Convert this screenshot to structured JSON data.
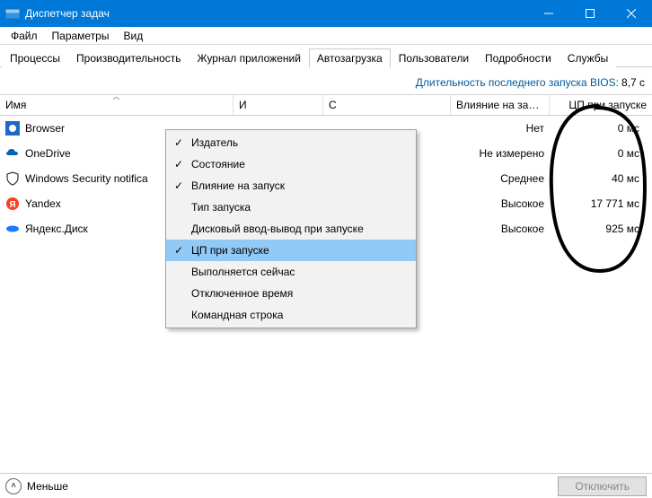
{
  "window": {
    "title": "Диспетчер задач"
  },
  "menu": {
    "file": "Файл",
    "options": "Параметры",
    "view": "Вид"
  },
  "tabs": {
    "processes": "Процессы",
    "performance": "Производительность",
    "apphistory": "Журнал приложений",
    "startup": "Автозагрузка",
    "users": "Пользователи",
    "details": "Подробности",
    "services": "Службы",
    "active": "startup"
  },
  "bios": {
    "label": "Длительность последнего запуска BIOS:",
    "value": "8,7 с"
  },
  "columns": {
    "name": "Имя",
    "publisher": "И",
    "state": "С",
    "impact": "Влияние на за…",
    "cpu": "ЦП при запуске"
  },
  "rows": [
    {
      "icon": "browser",
      "name": "Browser",
      "impact": "Нет",
      "cpu": "0 мс"
    },
    {
      "icon": "onedrive",
      "name": "OneDrive",
      "impact": "Не измерено",
      "cpu": "0 мс"
    },
    {
      "icon": "shield",
      "name": "Windows Security notifica",
      "impact": "Среднее",
      "cpu": "40 мс"
    },
    {
      "icon": "yandex",
      "name": "Yandex",
      "impact": "Высокое",
      "cpu": "17 771 мс"
    },
    {
      "icon": "disk",
      "name": "Яндекс.Диск",
      "impact": "Высокое",
      "cpu": "925 мс"
    }
  ],
  "context_menu": {
    "items": [
      {
        "label": "Издатель",
        "checked": true,
        "selected": false
      },
      {
        "label": "Состояние",
        "checked": true,
        "selected": false
      },
      {
        "label": "Влияние на запуск",
        "checked": true,
        "selected": false
      },
      {
        "label": "Тип запуска",
        "checked": false,
        "selected": false
      },
      {
        "label": "Дисковый ввод-вывод при запуске",
        "checked": false,
        "selected": false
      },
      {
        "label": "ЦП при запуске",
        "checked": true,
        "selected": true
      },
      {
        "label": "Выполняется сейчас",
        "checked": false,
        "selected": false
      },
      {
        "label": "Отключенное время",
        "checked": false,
        "selected": false
      },
      {
        "label": "Командная строка",
        "checked": false,
        "selected": false
      }
    ]
  },
  "footer": {
    "less": "Меньше",
    "disable": "Отключить"
  }
}
